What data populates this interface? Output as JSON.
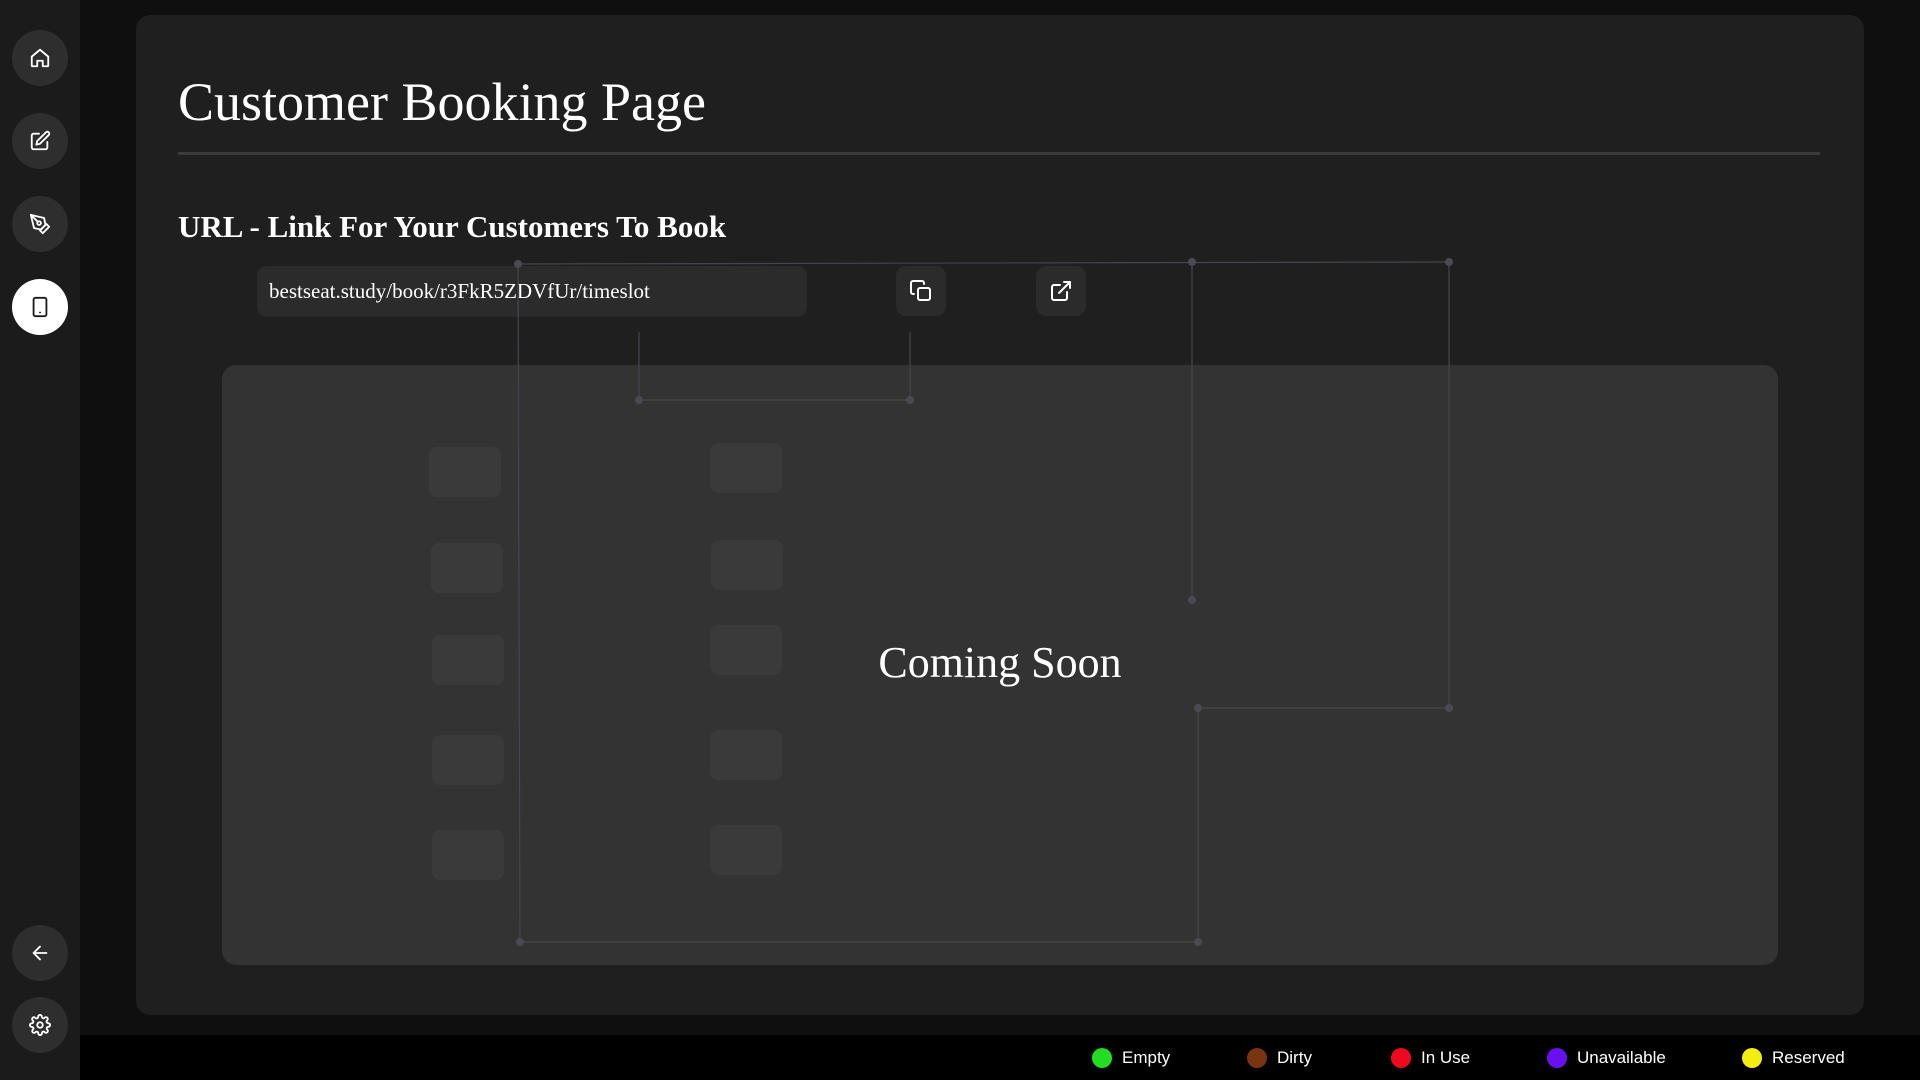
{
  "sidebar": {
    "items": [
      {
        "name": "home",
        "icon": "home-icon"
      },
      {
        "name": "edit",
        "icon": "edit-icon"
      },
      {
        "name": "design",
        "icon": "pen-tool-icon"
      },
      {
        "name": "booking",
        "icon": "tablet-icon",
        "active": true
      }
    ],
    "bottom": [
      {
        "name": "back",
        "icon": "arrow-left-icon"
      },
      {
        "name": "settings",
        "icon": "gear-icon"
      }
    ]
  },
  "page": {
    "title": "Customer Booking Page",
    "section_heading": "URL - Link For Your Customers To Book",
    "url": "bestseat.study/book/r3FkR5ZDVfUr/timeslot",
    "copy_icon": "copy-icon",
    "open_icon": "external-link-icon"
  },
  "preview": {
    "message": "Coming Soon"
  },
  "legend": {
    "items": [
      {
        "label": "Empty",
        "color": "#22dd22"
      },
      {
        "label": "Dirty",
        "color": "#7a3510"
      },
      {
        "label": "In Use",
        "color": "#ee0a1e"
      },
      {
        "label": "Unavailable",
        "color": "#6a10f0"
      },
      {
        "label": "Reserved",
        "color": "#f4ee10"
      }
    ]
  }
}
